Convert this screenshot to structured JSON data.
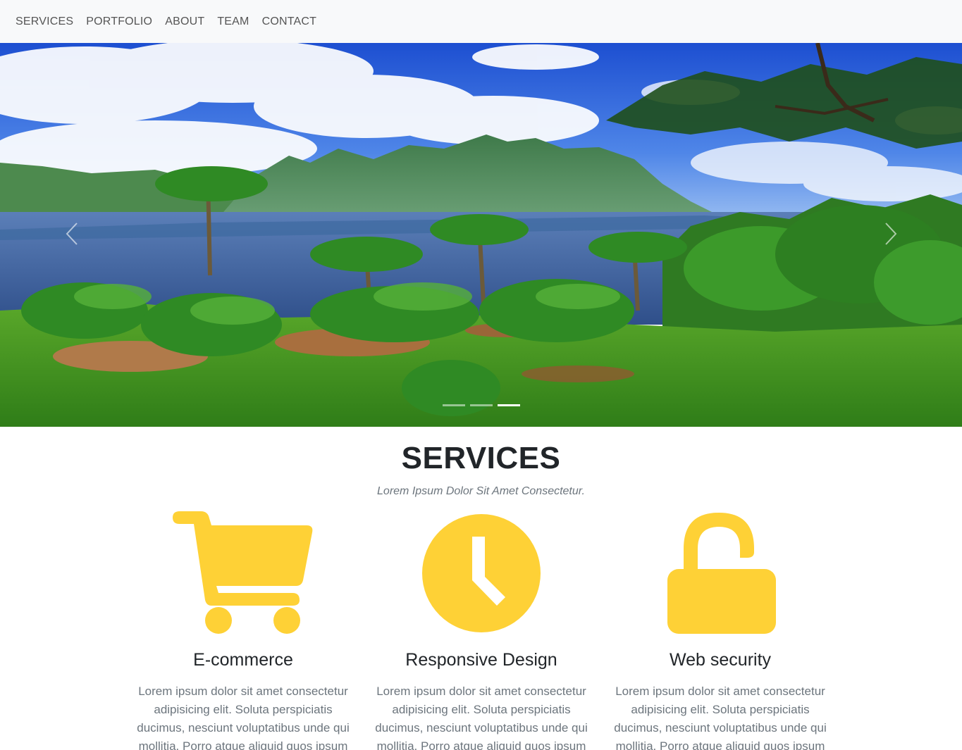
{
  "nav": {
    "items": [
      {
        "label": "Services"
      },
      {
        "label": "Portfolio"
      },
      {
        "label": "About"
      },
      {
        "label": "Team"
      },
      {
        "label": "Contact"
      }
    ]
  },
  "carousel": {
    "active_slide": 3,
    "slide_count": 3
  },
  "services": {
    "title": "SERVICES",
    "subtitle": "Lorem Ipsum Dolor Sit Amet Consectetur.",
    "accent_color": "#fed136",
    "items": [
      {
        "icon": "shopping-cart-icon",
        "heading": "E-commerce",
        "text": "Lorem ipsum dolor sit amet consectetur adipisicing elit. Soluta perspiciatis ducimus, nesciunt voluptatibus unde qui mollitia. Porro atque aliquid quos ipsum"
      },
      {
        "icon": "clock-icon",
        "heading": "Responsive Design",
        "text": "Lorem ipsum dolor sit amet consectetur adipisicing elit. Soluta perspiciatis ducimus, nesciunt voluptatibus unde qui mollitia. Porro atque aliquid quos ipsum"
      },
      {
        "icon": "unlock-icon",
        "heading": "Web security",
        "text": "Lorem ipsum dolor sit amet consectetur adipisicing elit. Soluta perspiciatis ducimus, nesciunt voluptatibus unde qui mollitia. Porro atque aliquid quos ipsum"
      }
    ]
  }
}
